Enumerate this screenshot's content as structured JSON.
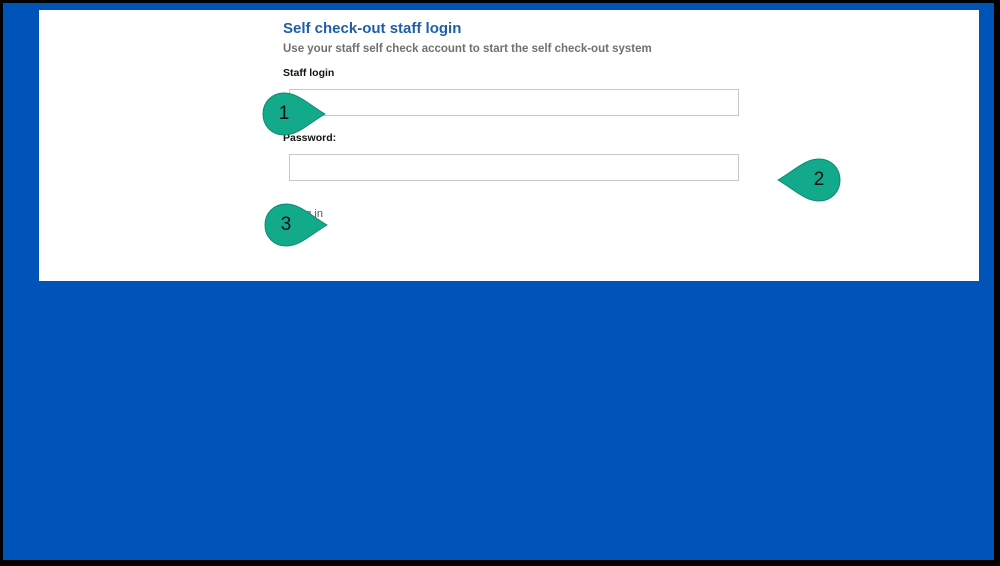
{
  "form": {
    "title": "Self check-out staff login",
    "subtitle": "Use your staff self check account to start the self check-out system",
    "staff_login_label": "Staff login",
    "staff_login_value": "",
    "password_label": "Password:",
    "password_value": "",
    "login_link": "Log in"
  },
  "callouts": {
    "one": "1",
    "two": "2",
    "three": "3"
  },
  "colors": {
    "background": "#0054b8",
    "panel": "#ffffff",
    "title": "#1f5fa8",
    "callout": "#13a98b"
  }
}
